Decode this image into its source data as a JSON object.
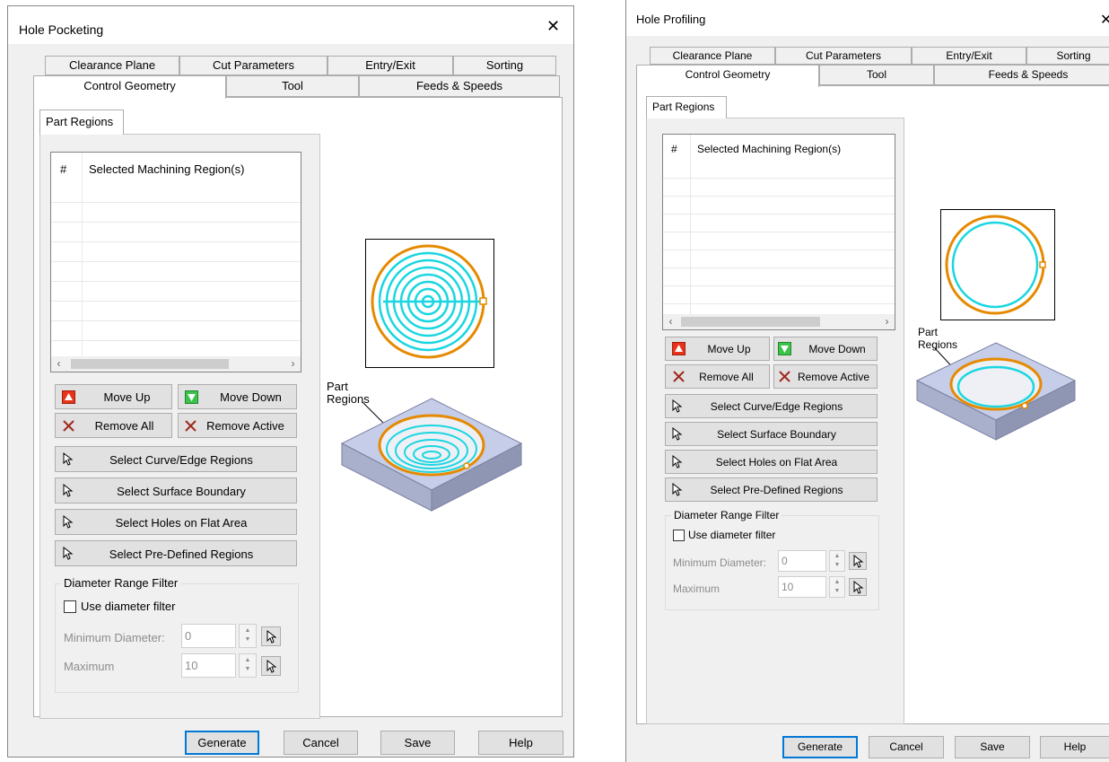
{
  "left": {
    "title": "Hole Pocketing",
    "close_glyph": "✕",
    "tabs_row1": [
      "Clearance Plane",
      "Cut Parameters",
      "Entry/Exit",
      "Sorting"
    ],
    "tabs_row2": [
      "Control Geometry",
      "Tool",
      "Feeds & Speeds"
    ],
    "subtab": "Part Regions",
    "list_header_num": "#",
    "list_header_col": "Selected Machining Region(s)",
    "move_up": "Move Up",
    "move_down": "Move Down",
    "remove_all": "Remove All",
    "remove_active": "Remove Active",
    "select_curve": "Select Curve/Edge Regions",
    "select_surface": "Select Surface Boundary",
    "select_holes": "Select Holes on Flat Area",
    "select_predef": "Select Pre-Defined Regions",
    "group_label": "Diameter Range Filter",
    "use_filter": "Use diameter filter",
    "min_label": "Minimum Diameter:",
    "min_value": "0",
    "max_label": "Maximum",
    "max_value": "10",
    "annotation": "Part\nRegions",
    "generate": "Generate",
    "cancel": "Cancel",
    "save": "Save",
    "help": "Help"
  },
  "right": {
    "title": "Hole Profiling",
    "close_glyph": "✕",
    "tabs_row1": [
      "Clearance Plane",
      "Cut Parameters",
      "Entry/Exit",
      "Sorting"
    ],
    "tabs_row2": [
      "Control Geometry",
      "Tool",
      "Feeds & Speeds"
    ],
    "subtab": "Part Regions",
    "list_header_num": "#",
    "list_header_col": "Selected Machining Region(s)",
    "move_up": "Move Up",
    "move_down": "Move Down",
    "remove_all": "Remove All",
    "remove_active": "Remove Active",
    "select_curve": "Select Curve/Edge Regions",
    "select_surface": "Select Surface Boundary",
    "select_holes": "Select Holes on Flat Area",
    "select_predef": "Select Pre-Defined Regions",
    "group_label": "Diameter Range Filter",
    "use_filter": "Use diameter filter",
    "min_label": "Minimum Diameter:",
    "min_value": "0",
    "max_label": "Maximum",
    "max_value": "10",
    "annotation": "Part\nRegions",
    "generate": "Generate",
    "cancel": "Cancel",
    "save": "Save",
    "help": "Help"
  },
  "colors": {
    "accent_orange": "#e58a00",
    "toolpath_cyan": "#1ad6e0",
    "stock_blue": "#c6cde8",
    "default_border": "#0078d7"
  }
}
